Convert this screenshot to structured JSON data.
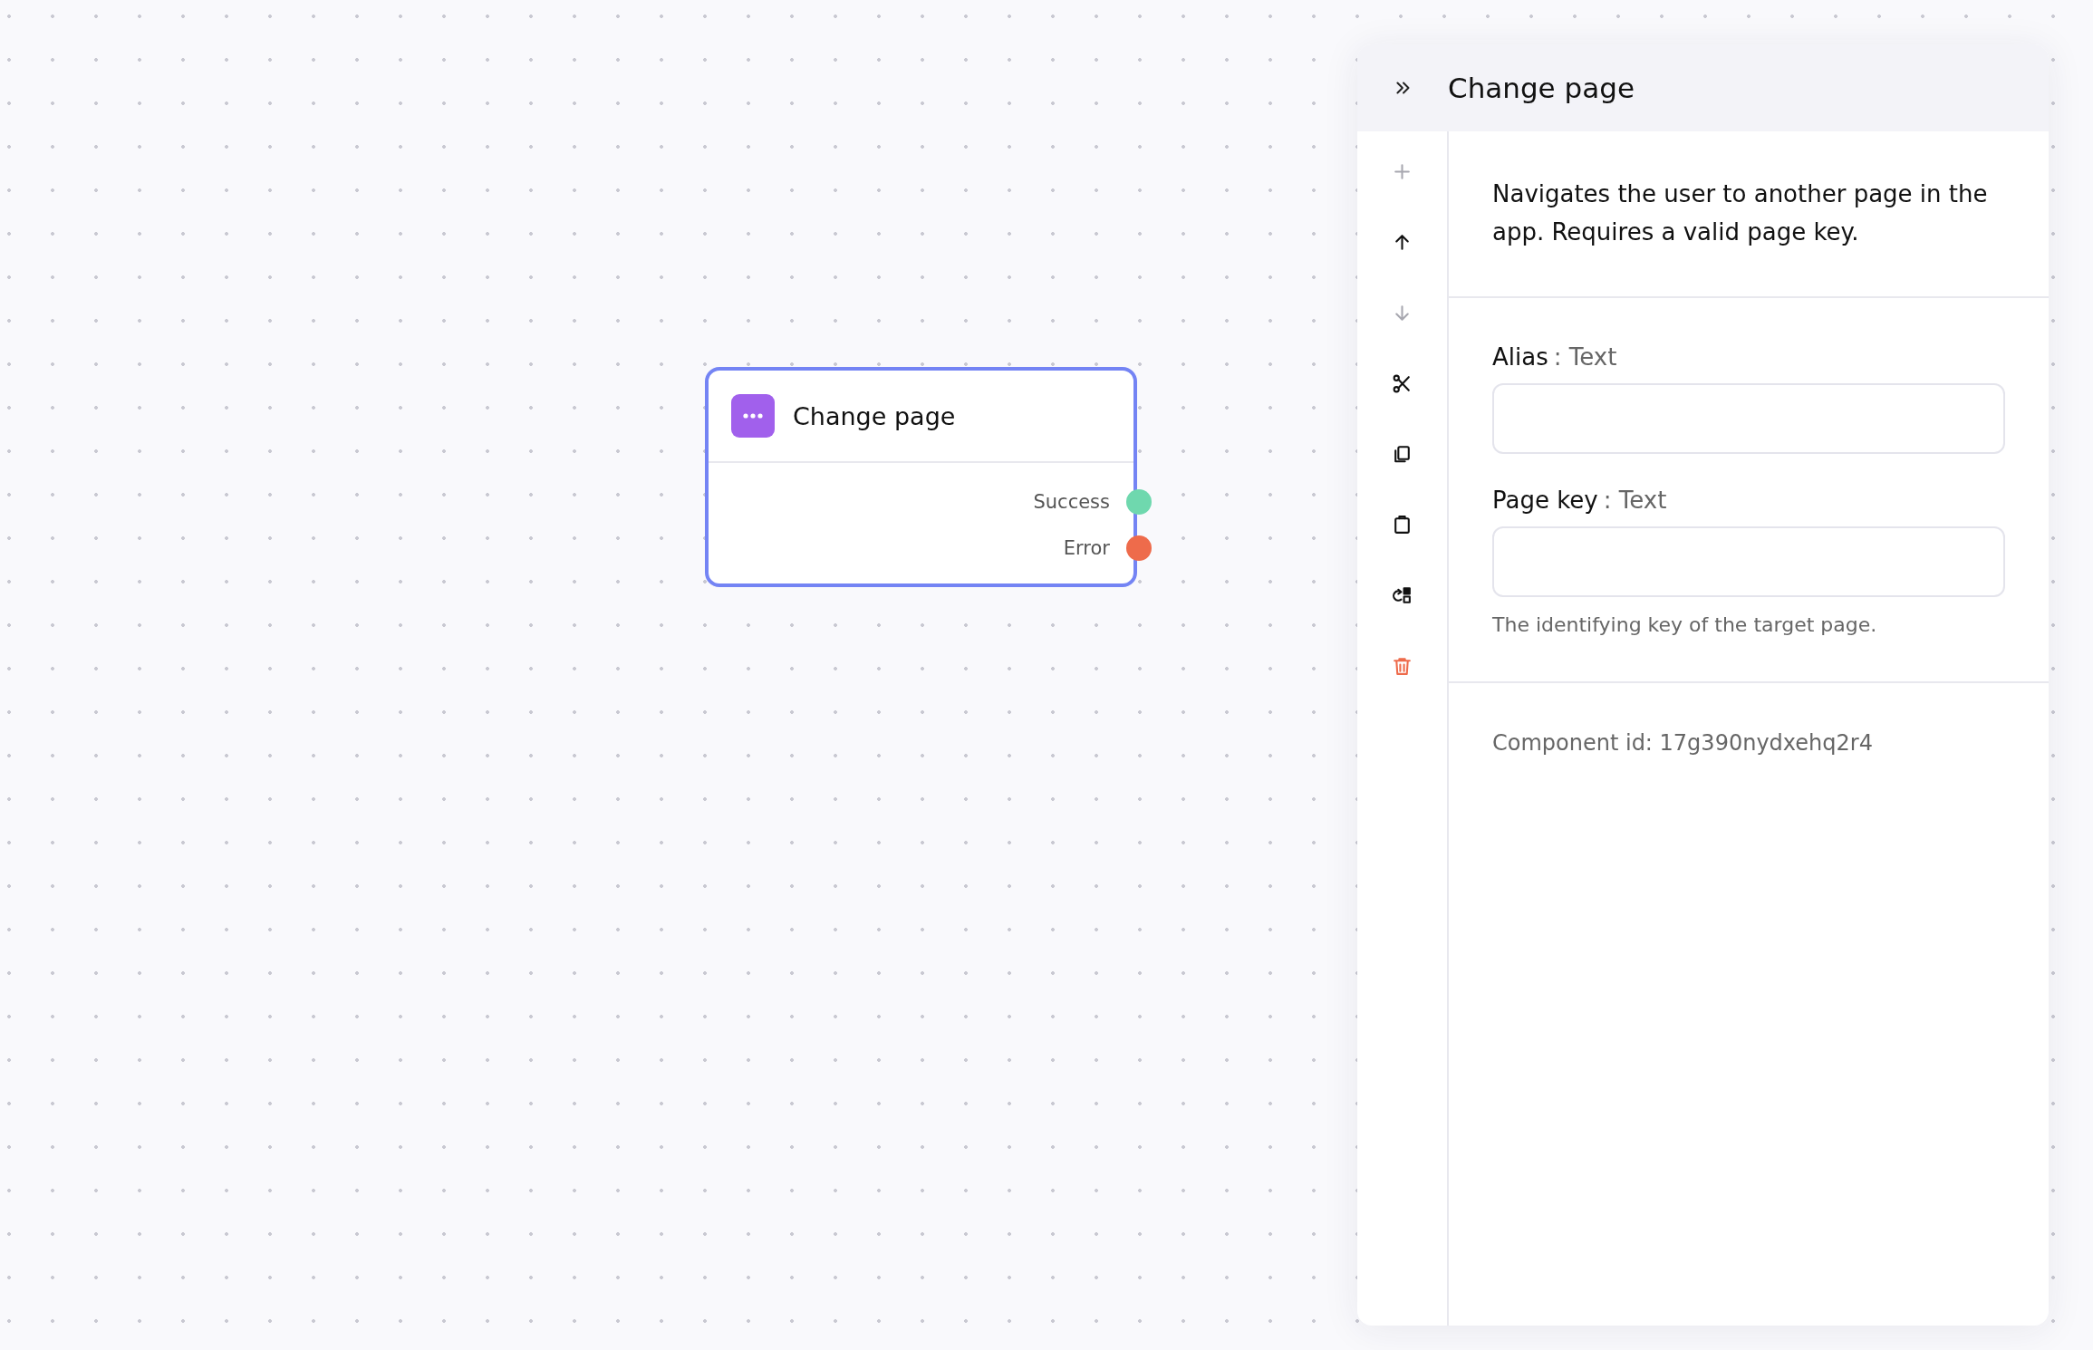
{
  "node": {
    "title": "Change page",
    "selected": true,
    "outputs": [
      {
        "label": "Success",
        "color": "#6fd8ae"
      },
      {
        "label": "Error",
        "color": "#ee6b4b"
      }
    ]
  },
  "panel": {
    "title": "Change page",
    "toolbar": [
      {
        "kind": "add",
        "disabled": true
      },
      {
        "kind": "move-up",
        "disabled": false
      },
      {
        "kind": "move-down",
        "disabled": true
      },
      {
        "kind": "cut",
        "disabled": false
      },
      {
        "kind": "copy",
        "disabled": false
      },
      {
        "kind": "paste",
        "disabled": false
      },
      {
        "kind": "replace",
        "disabled": false
      },
      {
        "kind": "delete",
        "disabled": false
      }
    ],
    "description": "Navigates the user to another page in the app. Requires a valid page key.",
    "fields": [
      {
        "label": "Alias",
        "type": ": Text"
      },
      {
        "label": "Page key",
        "type": ": Text",
        "help": "The identifying key of the target page."
      }
    ],
    "component_id": "Component id: 17g390nydxehq2r4"
  }
}
